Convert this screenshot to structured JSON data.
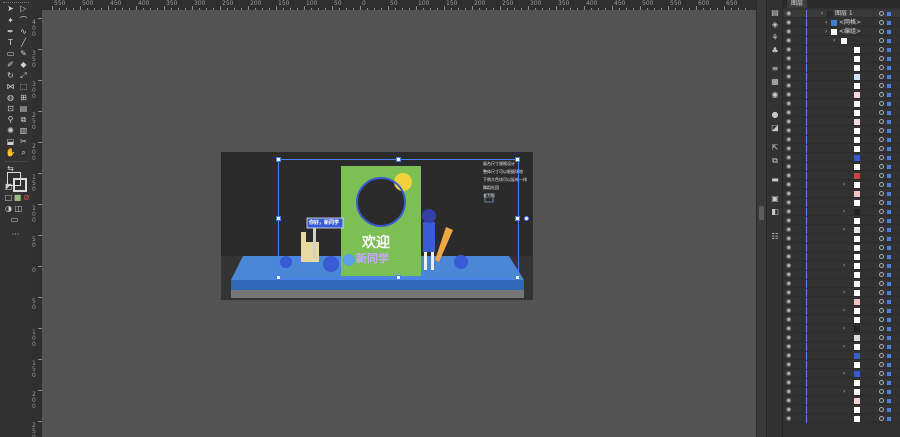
{
  "ruler": {
    "h_labels": [
      "550",
      "500",
      "450",
      "400",
      "350",
      "300",
      "250",
      "200",
      "150",
      "100",
      "50",
      "0",
      "50",
      "100",
      "150",
      "200",
      "250",
      "300",
      "350",
      "400",
      "450",
      "500",
      "550",
      "600",
      "650"
    ],
    "v_labels": [
      "400",
      "350",
      "300",
      "250",
      "200",
      "150",
      "100",
      "50",
      "0",
      "50",
      "100",
      "150",
      "200",
      "250"
    ]
  },
  "panel": {
    "tab_label": "图层",
    "layer_name": "图层 1",
    "group_name": "<编组>",
    "grid_name": "<网格>",
    "sublayer_name": "<编组>"
  },
  "artwork": {
    "sign_text": "你好，新同学",
    "welcome_text": "欢迎",
    "newkid_text": "新同学",
    "desc_lines": [
      "展台尺寸规格设计",
      "整体尺寸可以根据场地",
      "下侧大色块可以延伸一排",
      "舞蹈社团",
      "长方形"
    ]
  },
  "colors": {
    "selection": "#4a7cff",
    "panel_bg": "#323232",
    "canvas_bg": "#535353",
    "artboard_bg": "#2b2b2b",
    "stage_blue": "#3c77c8",
    "board_green": "#7bbf55"
  }
}
